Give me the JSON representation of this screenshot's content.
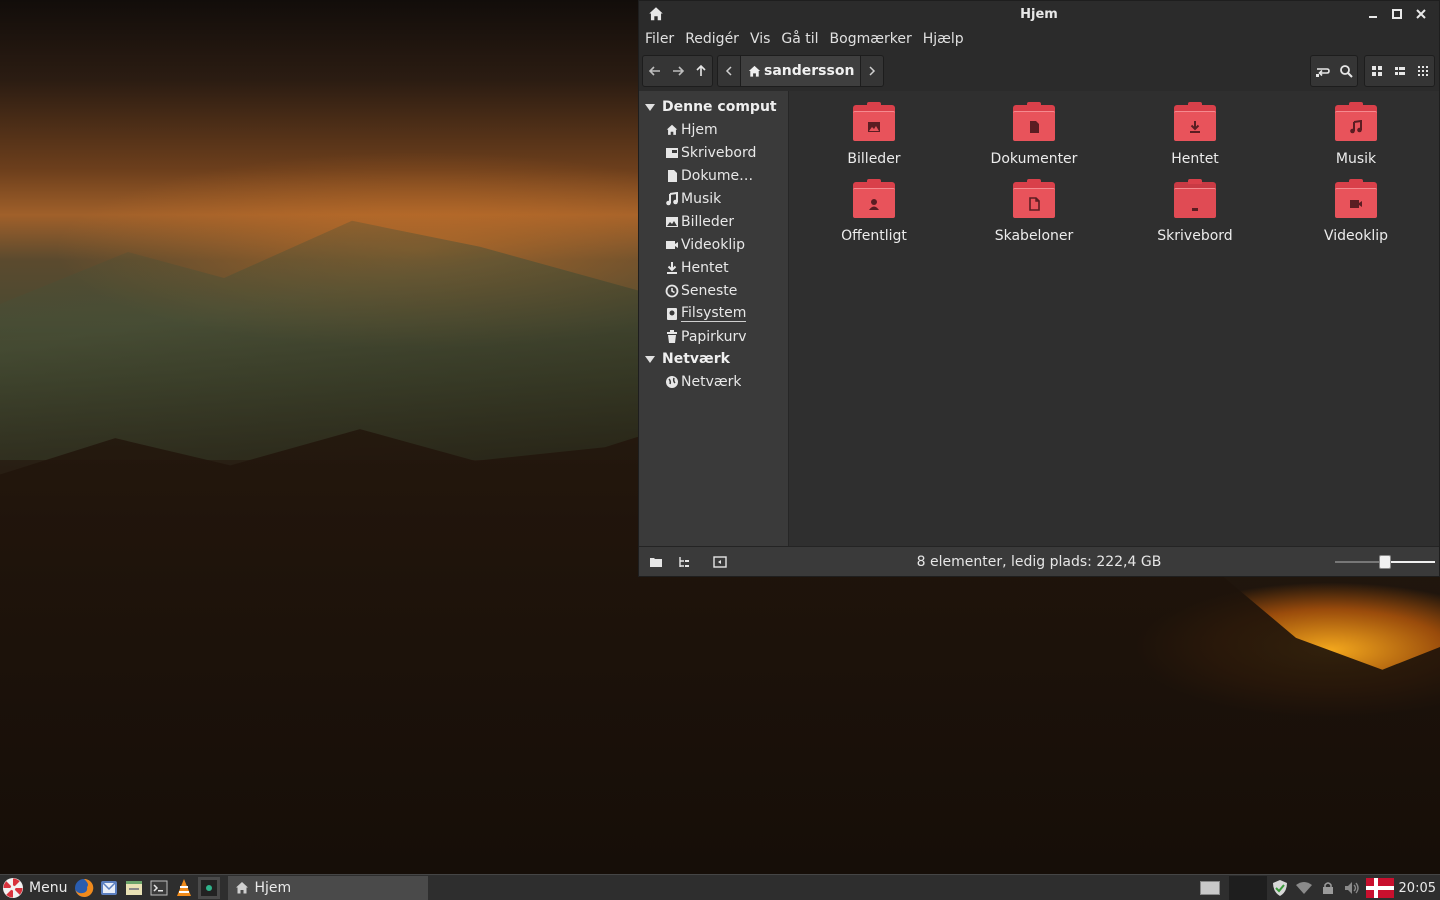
{
  "window": {
    "title": "Hjem",
    "menu": [
      "Filer",
      "Redigér",
      "Vis",
      "Gå til",
      "Bogmærker",
      "Hjælp"
    ],
    "path": {
      "current": "sandersson"
    }
  },
  "sidebar": {
    "sections": [
      {
        "label": "Denne comput",
        "items": [
          {
            "label": "Hjem",
            "icon": "home-icon"
          },
          {
            "label": "Skrivebord",
            "icon": "desktop-icon"
          },
          {
            "label": "Dokume…",
            "icon": "document-icon"
          },
          {
            "label": "Musik",
            "icon": "music-icon"
          },
          {
            "label": "Billeder",
            "icon": "image-icon"
          },
          {
            "label": "Videoklip",
            "icon": "video-icon"
          },
          {
            "label": "Hentet",
            "icon": "download-icon"
          },
          {
            "label": "Seneste",
            "icon": "clock-icon"
          },
          {
            "label": "Filsystem",
            "icon": "drive-icon"
          },
          {
            "label": "Papirkurv",
            "icon": "trash-icon"
          }
        ]
      },
      {
        "label": "Netværk",
        "items": [
          {
            "label": "Netværk",
            "icon": "network-icon"
          }
        ]
      }
    ]
  },
  "files": [
    {
      "name": "Billeder",
      "icon": "folder-pictures-icon"
    },
    {
      "name": "Dokumenter",
      "icon": "folder-documents-icon"
    },
    {
      "name": "Hentet",
      "icon": "folder-download-icon"
    },
    {
      "name": "Musik",
      "icon": "folder-music-icon"
    },
    {
      "name": "Offentligt",
      "icon": "folder-public-icon"
    },
    {
      "name": "Skabeloner",
      "icon": "folder-templates-icon"
    },
    {
      "name": "Skrivebord",
      "icon": "folder-desktop-icon"
    },
    {
      "name": "Videoklip",
      "icon": "folder-videos-icon"
    }
  ],
  "status": {
    "text": "8 elementer, ledig plads: 222,4 GB",
    "zoom_level": 0.5
  },
  "taskbar": {
    "menu_label": "Menu",
    "task_label": "Hjem",
    "clock": "20:05"
  },
  "colors": {
    "folder_accent": "#e8535b",
    "window_bg": "#2f2f2f",
    "sidebar_bg": "#3a3a3a"
  }
}
